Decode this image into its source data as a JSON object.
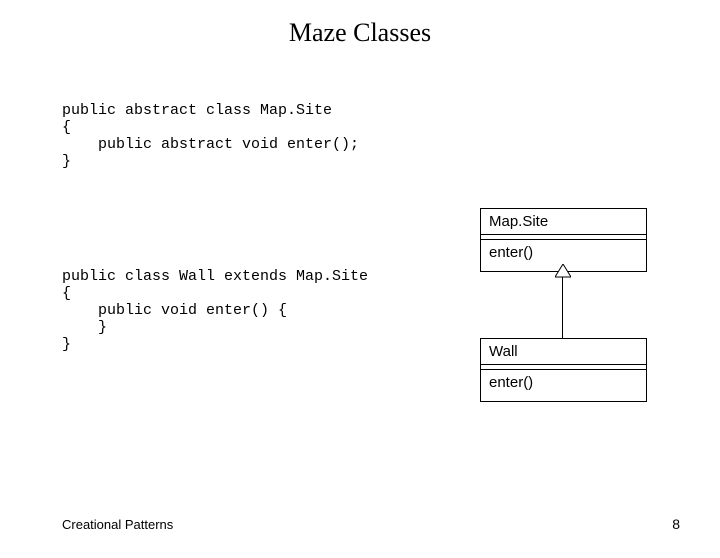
{
  "title": "Maze Classes",
  "code1": "public abstract class Map.Site\n{\n    public abstract void enter();\n}",
  "code2": "public class Wall extends Map.Site\n{\n    public void enter() {\n    }\n}",
  "uml": {
    "mapsite": {
      "name": "Map.Site",
      "ops": "enter()"
    },
    "wall": {
      "name": "Wall",
      "ops": "enter()"
    }
  },
  "footer": {
    "left": "Creational Patterns",
    "page": "8"
  }
}
